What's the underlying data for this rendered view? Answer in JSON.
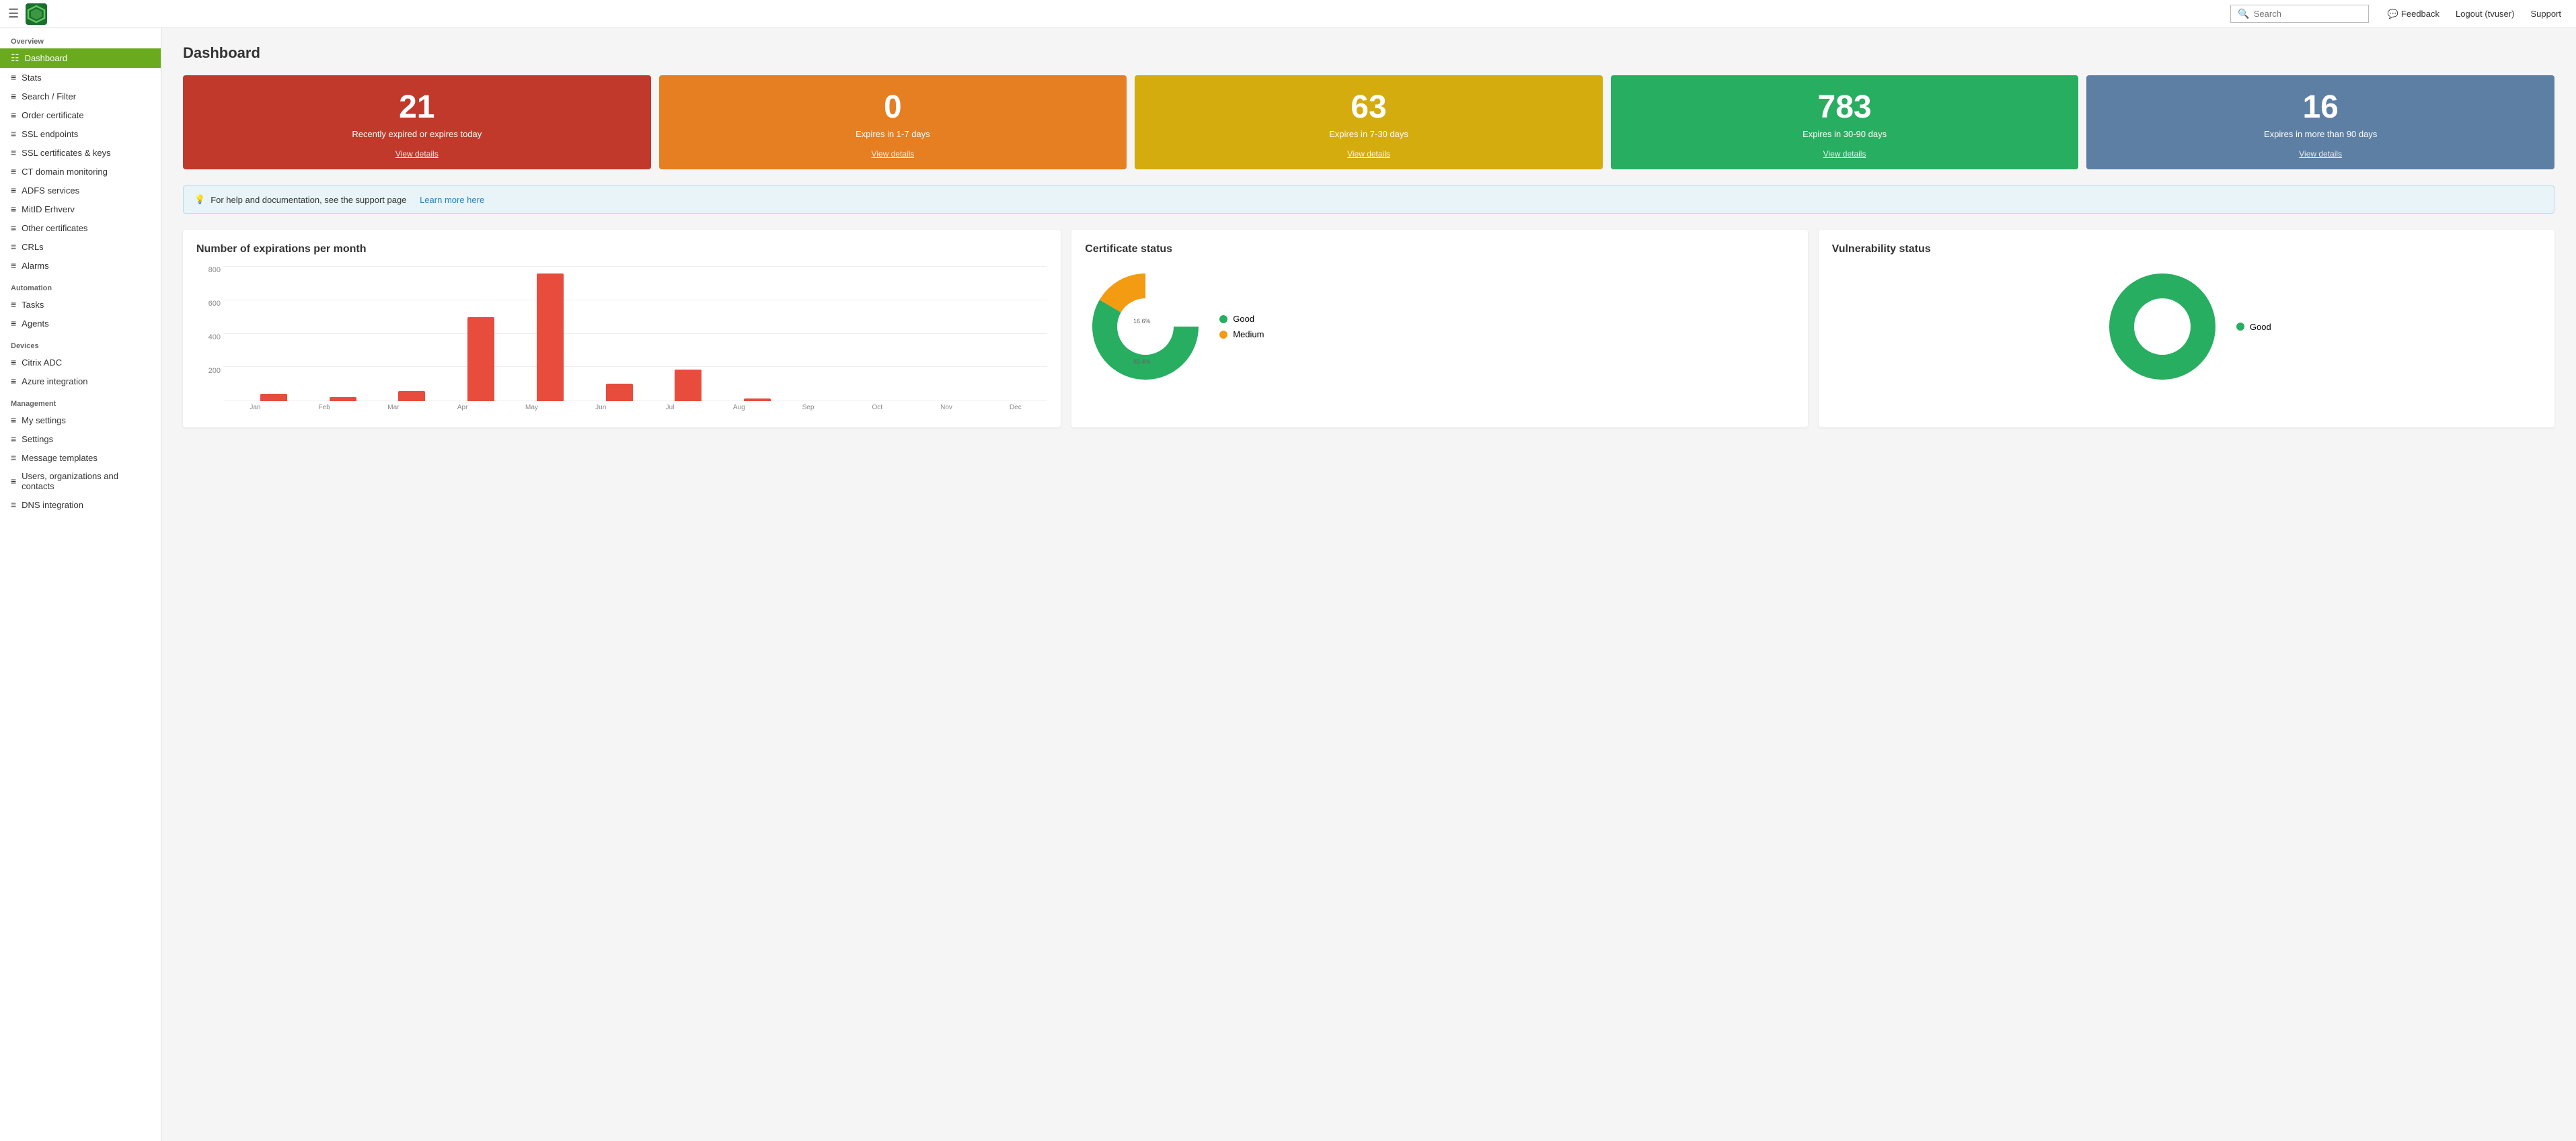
{
  "topbar": {
    "search_placeholder": "Search",
    "feedback_label": "Feedback",
    "logout_label": "Logout (tvuser)",
    "support_label": "Support"
  },
  "sidebar": {
    "overview_label": "Overview",
    "items_overview": [
      {
        "id": "dashboard",
        "label": "Dashboard",
        "active": true
      },
      {
        "id": "stats",
        "label": "Stats",
        "active": false
      },
      {
        "id": "search-filter",
        "label": "Search / Filter",
        "active": false
      },
      {
        "id": "order-certificate",
        "label": "Order certificate",
        "active": false
      }
    ],
    "items_ssl": [
      {
        "id": "ssl-endpoints",
        "label": "SSL endpoints"
      },
      {
        "id": "ssl-certs",
        "label": "SSL certificates & keys"
      }
    ],
    "items_monitoring": [
      {
        "id": "ct-domain",
        "label": "CT domain monitoring"
      },
      {
        "id": "adfs",
        "label": "ADFS services"
      },
      {
        "id": "mitid",
        "label": "MitID Erhverv"
      },
      {
        "id": "other-certs",
        "label": "Other certificates"
      },
      {
        "id": "crls",
        "label": "CRLs"
      },
      {
        "id": "alarms",
        "label": "Alarms"
      }
    ],
    "automation_label": "Automation",
    "items_automation": [
      {
        "id": "tasks",
        "label": "Tasks"
      },
      {
        "id": "agents",
        "label": "Agents"
      }
    ],
    "devices_label": "Devices",
    "items_devices": [
      {
        "id": "citrix-adc",
        "label": "Citrix ADC"
      },
      {
        "id": "azure-integration",
        "label": "Azure integration"
      }
    ],
    "management_label": "Management",
    "items_management": [
      {
        "id": "my-settings",
        "label": "My settings"
      },
      {
        "id": "settings",
        "label": "Settings"
      },
      {
        "id": "message-templates",
        "label": "Message templates"
      },
      {
        "id": "users-orgs",
        "label": "Users, organizations and contacts"
      },
      {
        "id": "dns-integration",
        "label": "DNS integration"
      }
    ]
  },
  "dashboard": {
    "title": "Dashboard",
    "stat_cards": [
      {
        "id": "expired",
        "number": "21",
        "label": "Recently expired or expires today",
        "link": "View details",
        "color": "card-red"
      },
      {
        "id": "expires-1-7",
        "number": "0",
        "label": "Expires in 1-7 days",
        "link": "View details",
        "color": "card-orange"
      },
      {
        "id": "expires-7-30",
        "number": "63",
        "label": "Expires in 7-30 days",
        "link": "View details",
        "color": "card-yellow"
      },
      {
        "id": "expires-30-90",
        "number": "783",
        "label": "Expires in 30-90 days",
        "link": "View details",
        "color": "card-green"
      },
      {
        "id": "expires-90plus",
        "number": "16",
        "label": "Expires in more than 90 days",
        "link": "View details",
        "color": "card-blue"
      }
    ],
    "info_box": {
      "text": "For help and documentation, see the support page",
      "link_label": "Learn more here"
    },
    "chart_expirations": {
      "title": "Number of expirations per month",
      "y_labels": [
        "800",
        "600",
        "400",
        "200",
        ""
      ],
      "bars": [
        {
          "month": "Jan",
          "value": 20,
          "height_pct": 5
        },
        {
          "month": "Feb",
          "value": 10,
          "height_pct": 3
        },
        {
          "month": "Mar",
          "value": 30,
          "height_pct": 7
        },
        {
          "month": "Apr",
          "value": 460,
          "height_pct": 58
        },
        {
          "month": "May",
          "value": 700,
          "height_pct": 88
        },
        {
          "month": "Jun",
          "value": 50,
          "height_pct": 12
        },
        {
          "month": "Jul",
          "value": 180,
          "height_pct": 22
        },
        {
          "month": "Aug",
          "value": 10,
          "height_pct": 2
        },
        {
          "month": "Sep",
          "value": 0,
          "height_pct": 0
        },
        {
          "month": "Oct",
          "value": 0,
          "height_pct": 0
        },
        {
          "month": "Nov",
          "value": 0,
          "height_pct": 0
        },
        {
          "month": "Dec",
          "value": 0,
          "height_pct": 0
        }
      ]
    },
    "chart_cert_status": {
      "title": "Certificate status",
      "legend": [
        {
          "label": "Good",
          "color": "#27ae60"
        },
        {
          "label": "Medium",
          "color": "#f39c12"
        }
      ],
      "segments": [
        {
          "label": "Good",
          "pct": 83.4,
          "color": "#27ae60"
        },
        {
          "label": "Medium",
          "pct": 16.6,
          "color": "#f39c12"
        }
      ],
      "label_good": "83.4%",
      "label_medium": "16.6%"
    },
    "chart_vuln_status": {
      "title": "Vulnerability status",
      "legend": [
        {
          "label": "Good",
          "color": "#27ae60"
        }
      ],
      "segments": [
        {
          "label": "Good",
          "pct": 100,
          "color": "#27ae60"
        }
      ]
    }
  }
}
